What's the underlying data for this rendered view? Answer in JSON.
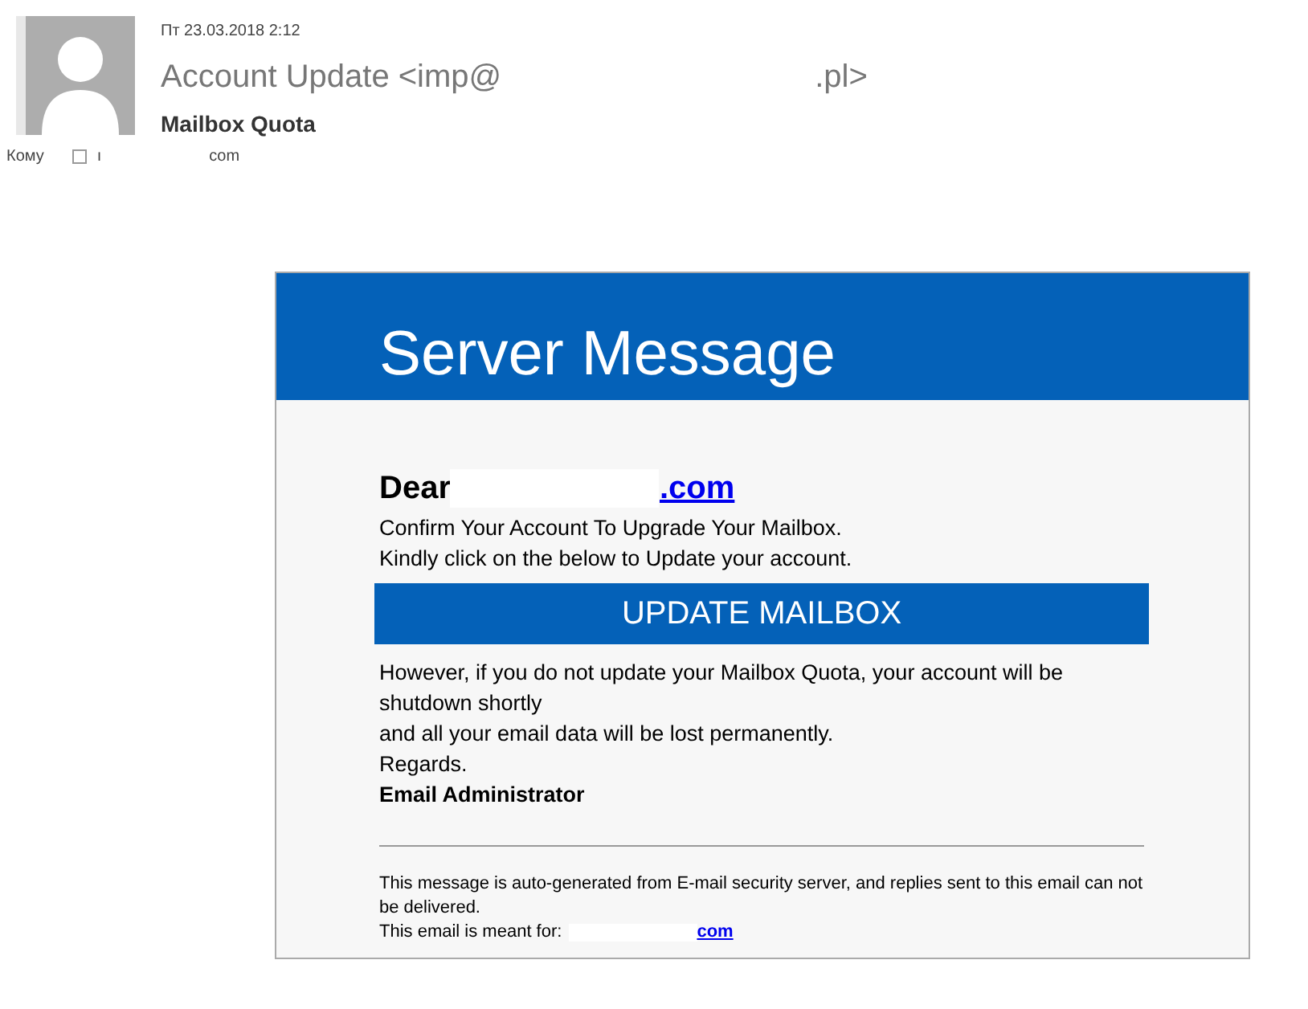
{
  "header": {
    "date": "Пт 23.03.2018 2:12",
    "from_start": "Account Update <imp@",
    "from_end": ".pl>",
    "subject": "Mailbox Quota",
    "to_label": "Кому",
    "to_start": "ı",
    "to_end": "com"
  },
  "message": {
    "banner": "Server Message",
    "greeting": "Dear",
    "greeting_link": ".com",
    "lines": [
      "Confirm Your Account To Upgrade Your Mailbox.",
      "Kindly click on the below to Update your account."
    ],
    "button": "UPDATE MAILBOX",
    "body": [
      "However, if you do not update your Mailbox Quota, your account will be shutdown shortly",
      "and all your email data will be lost permanently.",
      "Regards."
    ],
    "signature": "Email Administrator",
    "footer": "This message is auto-generated from E-mail security server, and replies sent to this email can not be delivered.",
    "meant_for": "This email is meant for:",
    "meant_link": "com"
  }
}
